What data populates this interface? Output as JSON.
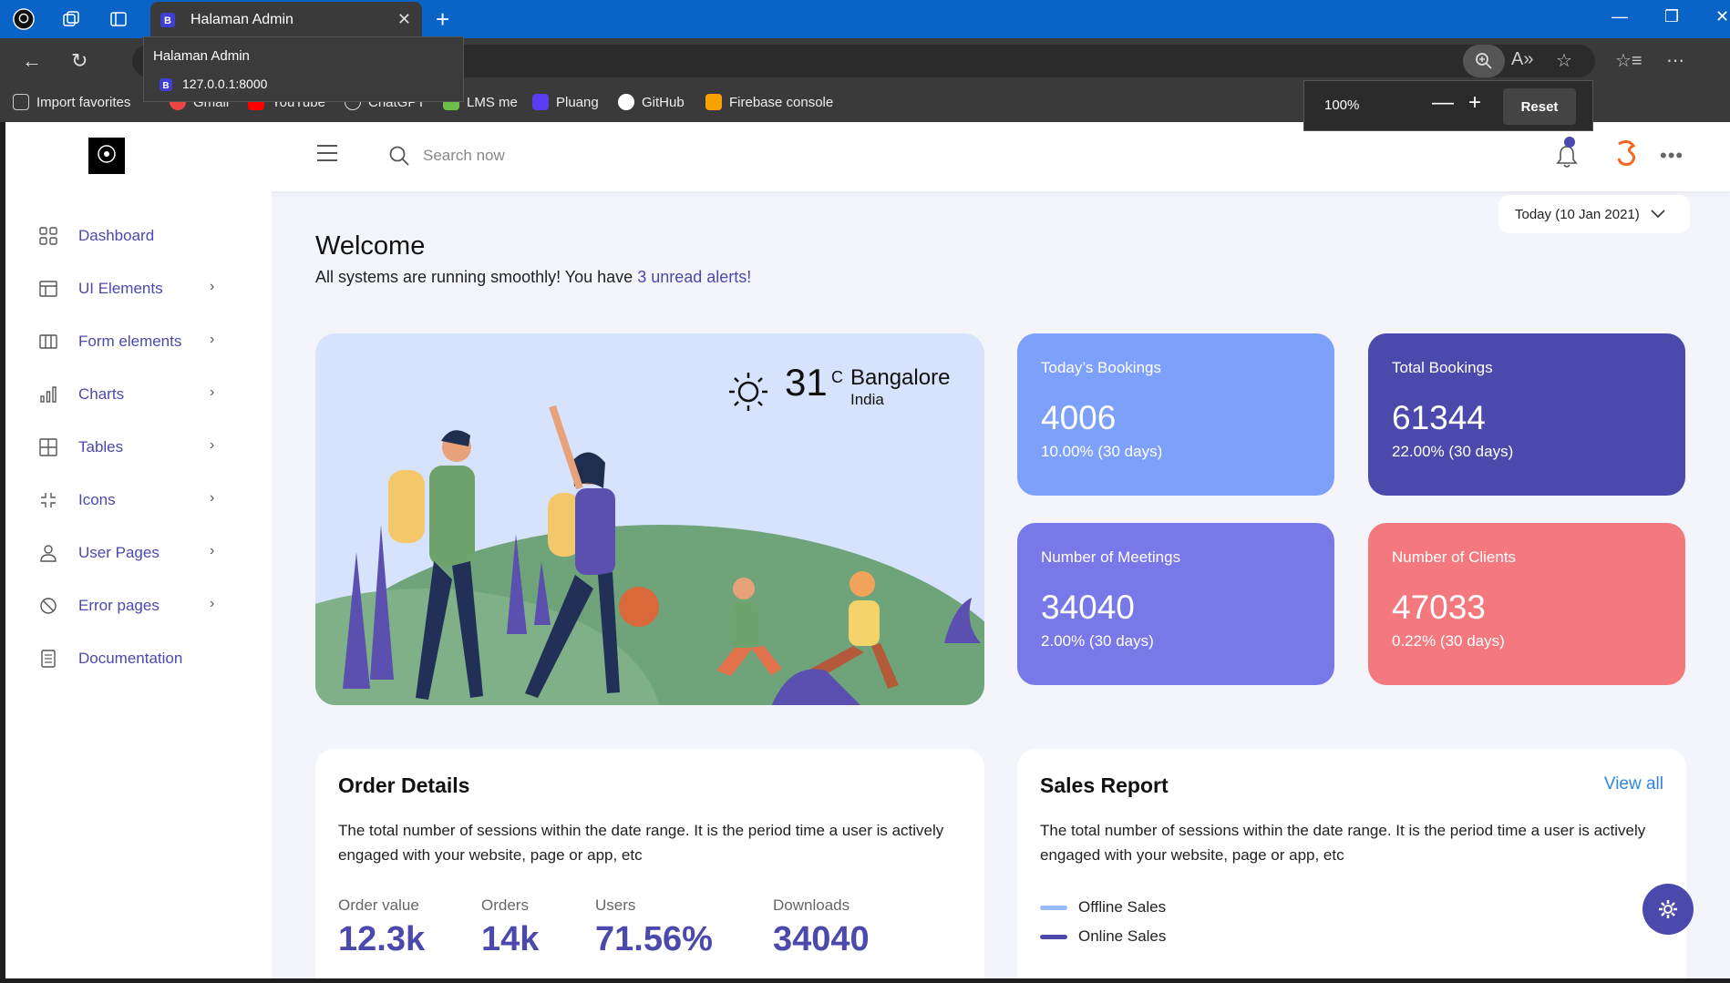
{
  "browser": {
    "tab_title": "Halaman Admin",
    "tooltip_title": "Halaman Admin",
    "tooltip_url": "127.0.0.1:8000",
    "zoom_level": "100%",
    "zoom_reset": "Reset",
    "favorites": [
      "Import favorites",
      "Gmail",
      "YouTube",
      "ChatGPT",
      "LMS me",
      "Pluang",
      "GitHub",
      "Firebase console"
    ]
  },
  "topnav": {
    "search_placeholder": "Search now"
  },
  "sidebar": {
    "items": [
      {
        "label": "Dashboard",
        "icon": "grid-icon",
        "has_arrow": false
      },
      {
        "label": "UI Elements",
        "icon": "layout-icon",
        "has_arrow": true
      },
      {
        "label": "Form elements",
        "icon": "columns-icon",
        "has_arrow": true
      },
      {
        "label": "Charts",
        "icon": "bar-chart-icon",
        "has_arrow": true
      },
      {
        "label": "Tables",
        "icon": "table-icon",
        "has_arrow": true
      },
      {
        "label": "Icons",
        "icon": "compress-icon",
        "has_arrow": true
      },
      {
        "label": "User Pages",
        "icon": "user-icon",
        "has_arrow": true
      },
      {
        "label": "Error pages",
        "icon": "ban-icon",
        "has_arrow": true
      },
      {
        "label": "Documentation",
        "icon": "document-icon",
        "has_arrow": false
      }
    ]
  },
  "main": {
    "welcome_title": "Welcome",
    "subtitle_prefix": "All systems are running smoothly! You have ",
    "subtitle_alert": "3 unread alerts!",
    "date_button": "Today (10 Jan 2021)",
    "weather": {
      "temperature": "31",
      "unit": "C",
      "city": "Bangalore",
      "country": "India"
    },
    "stats": [
      {
        "title": "Today’s Bookings",
        "value": "4006",
        "sub": "10.00% (30 days)",
        "color": "#7da0fa"
      },
      {
        "title": "Total Bookings",
        "value": "61344",
        "sub": "22.00% (30 days)",
        "color": "#4b49ac"
      },
      {
        "title": "Number of Meetings",
        "value": "34040",
        "sub": "2.00% (30 days)",
        "color": "#7978e9"
      },
      {
        "title": "Number of Clients",
        "value": "47033",
        "sub": "0.22% (30 days)",
        "color": "#f3797e"
      }
    ],
    "order_details": {
      "title": "Order Details",
      "description": "The total number of sessions within the date range. It is the period time a user is actively engaged with your website, page or app, etc",
      "metrics": [
        {
          "label": "Order value",
          "value": "12.3k"
        },
        {
          "label": "Orders",
          "value": "14k"
        },
        {
          "label": "Users",
          "value": "71.56%"
        },
        {
          "label": "Downloads",
          "value": "34040"
        }
      ]
    },
    "sales_report": {
      "title": "Sales Report",
      "view_all": "View all",
      "description": "The total number of sessions within the date range. It is the period time a user is actively engaged with your website, page or app, etc",
      "legend": [
        {
          "label": "Offline Sales",
          "color": "#98bdff"
        },
        {
          "label": "Online Sales",
          "color": "#4b49ac"
        }
      ]
    }
  }
}
